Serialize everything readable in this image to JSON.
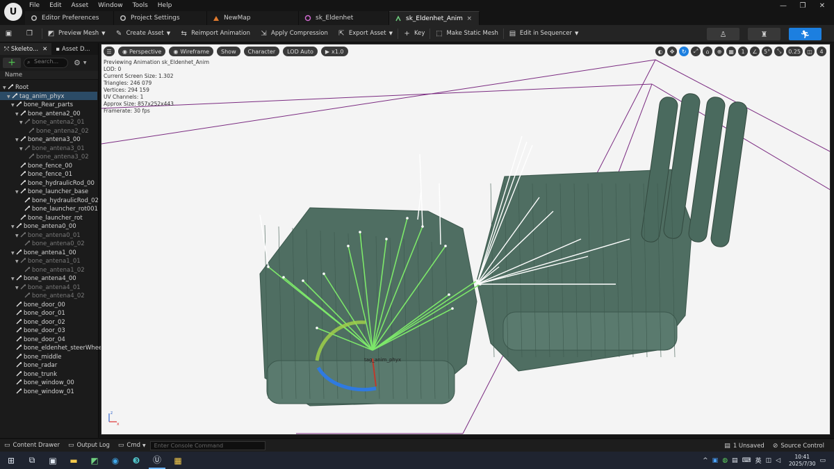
{
  "menu": [
    "File",
    "Edit",
    "Asset",
    "Window",
    "Tools",
    "Help"
  ],
  "logo": "U",
  "tabs": [
    {
      "label": "Editor Preferences",
      "icon": "gear-icon"
    },
    {
      "label": "Project Settings",
      "icon": "settings-icon"
    },
    {
      "label": "NewMap",
      "icon": "level-icon"
    },
    {
      "label": "sk_Eldenhet",
      "icon": "skeletal-mesh-icon"
    },
    {
      "label": "sk_Eldenhet_Anim",
      "icon": "animation-icon",
      "close": "×"
    }
  ],
  "window_controls": [
    "—",
    "❐",
    "✕"
  ],
  "toolbar": {
    "preview_mesh": "Preview Mesh",
    "create_asset": "Create Asset",
    "reimport": "Reimport Animation",
    "apply_compression": "Apply Compression",
    "export_asset": "Export Asset",
    "key": "Key",
    "make_static_mesh": "Make Static Mesh",
    "edit_in_sequencer": "Edit in Sequencer"
  },
  "left_panel": {
    "tab_skeleton": "Skeleto...",
    "tab_asset": "Asset D...",
    "search_placeholder": "Search...",
    "name_header": "Name",
    "tree": [
      {
        "label": "Root",
        "depth": 0,
        "dim": false
      },
      {
        "label": "tag_anim_phyx",
        "depth": 1,
        "dim": false,
        "selected": true
      },
      {
        "label": "bone_Rear_parts",
        "depth": 2,
        "dim": false
      },
      {
        "label": "bone_antena2_00",
        "depth": 3,
        "dim": false
      },
      {
        "label": "bone_antena2_01",
        "depth": 4,
        "dim": true
      },
      {
        "label": "bone_antena2_02",
        "depth": 5,
        "dim": true
      },
      {
        "label": "bone_antena3_00",
        "depth": 3,
        "dim": false
      },
      {
        "label": "bone_antena3_01",
        "depth": 4,
        "dim": true
      },
      {
        "label": "bone_antena3_02",
        "depth": 5,
        "dim": true
      },
      {
        "label": "bone_fence_00",
        "depth": 3,
        "dim": false
      },
      {
        "label": "bone_fence_01",
        "depth": 3,
        "dim": false
      },
      {
        "label": "bone_hydraulicRod_00",
        "depth": 3,
        "dim": false
      },
      {
        "label": "bone_launcher_base",
        "depth": 3,
        "dim": false
      },
      {
        "label": "bone_hydraulicRod_02",
        "depth": 4,
        "dim": false
      },
      {
        "label": "bone_launcher_rot001",
        "depth": 4,
        "dim": false
      },
      {
        "label": "bone_launcher_rot",
        "depth": 3,
        "dim": false
      },
      {
        "label": "bone_antena0_00",
        "depth": 2,
        "dim": false
      },
      {
        "label": "bone_antena0_01",
        "depth": 3,
        "dim": true
      },
      {
        "label": "bone_antena0_02",
        "depth": 4,
        "dim": true
      },
      {
        "label": "bone_antena1_00",
        "depth": 2,
        "dim": false
      },
      {
        "label": "bone_antena1_01",
        "depth": 3,
        "dim": true
      },
      {
        "label": "bone_antena1_02",
        "depth": 4,
        "dim": true
      },
      {
        "label": "bone_antena4_00",
        "depth": 2,
        "dim": false
      },
      {
        "label": "bone_antena4_01",
        "depth": 3,
        "dim": true
      },
      {
        "label": "bone_antena4_02",
        "depth": 4,
        "dim": true
      },
      {
        "label": "bone_door_00",
        "depth": 2,
        "dim": false
      },
      {
        "label": "bone_door_01",
        "depth": 2,
        "dim": false
      },
      {
        "label": "bone_door_02",
        "depth": 2,
        "dim": false
      },
      {
        "label": "bone_door_03",
        "depth": 2,
        "dim": false
      },
      {
        "label": "bone_door_04",
        "depth": 2,
        "dim": false
      },
      {
        "label": "bone_eldenhet_steerWheel",
        "depth": 2,
        "dim": false
      },
      {
        "label": "bone_middle",
        "depth": 2,
        "dim": false
      },
      {
        "label": "bone_radar",
        "depth": 2,
        "dim": false
      },
      {
        "label": "bone_trunk",
        "depth": 2,
        "dim": false
      },
      {
        "label": "bone_window_00",
        "depth": 2,
        "dim": false
      },
      {
        "label": "bone_window_01",
        "depth": 2,
        "dim": false
      }
    ]
  },
  "viewport": {
    "menu_icon": "☰",
    "perspective": "Perspective",
    "wireframe": "Wireframe",
    "show": "Show",
    "character": "Character",
    "lod": "LOD Auto",
    "play_speed": "x1.0",
    "grid_size": "1",
    "rotation_snap": "5°",
    "scale_snap": "0.25",
    "camera_speed": "4",
    "stats": [
      "Previewing Animation sk_Eldenhet_Anim",
      "LOD: 0",
      "Current Screen Size: 1.302",
      "Triangles: 246 079",
      "Vertices: 294 159",
      "UV Channels: 1",
      "Approx Size: 857x252x443",
      "Framerate: 30 fps"
    ],
    "bone_label": "tag_anim_phyx",
    "axis_x": "x",
    "axis_z": "z"
  },
  "bottom": {
    "content_drawer": "Content Drawer",
    "output_log": "Output Log",
    "cmd": "Cmd",
    "console_placeholder": "Enter Console Command",
    "unsaved": "1 Unsaved",
    "source_control": "Source Control"
  },
  "taskbar": {
    "time": "10:41",
    "date": "2025/7/30",
    "ime": "英"
  },
  "colors": {
    "accent_blue": "#1c7fe0",
    "mesh": "#4f6e62",
    "bone_green": "#7de86a",
    "bounds": "#7a2a80"
  }
}
